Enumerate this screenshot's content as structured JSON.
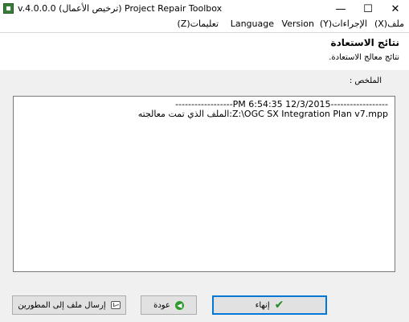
{
  "window": {
    "title": "v.4.0.0.0 (ترخيص الأعمال) Project Repair Toolbox",
    "minimize_glyph": "—",
    "maximize_glyph": "☐",
    "close_glyph": "✕"
  },
  "menu": {
    "file": "ملف(X)",
    "actions": "الإجراءات(Y)",
    "version": "Version",
    "language": "Language",
    "help": "تعليمات(Z)"
  },
  "header": {
    "title": "نتائج الاستعادة",
    "subtitle": "نتائج معالج الاستعادة."
  },
  "summary": {
    "label": "الملخص :",
    "log_line1": "------------------PM 6:54:35 12/3/2015------------------",
    "log_line2": "الملف الذي تمت معالجته:Z:\\OGC SX Integration Plan v7.mpp"
  },
  "buttons": {
    "send": "إرسال ملف إلى المطورين",
    "back": "عودة",
    "finish": "إنهاء"
  },
  "icons": {
    "app": "app-icon",
    "send": "send-mail-icon",
    "back": "back-arrow-icon",
    "finish": "checkmark-icon",
    "back_glyph": "◀",
    "finish_glyph": "✔"
  },
  "colors": {
    "content_background": "#f0f0f0",
    "default_button_border": "#0078d7",
    "back_icon": "#2e9a2e",
    "check_icon": "#1f8a1f"
  }
}
